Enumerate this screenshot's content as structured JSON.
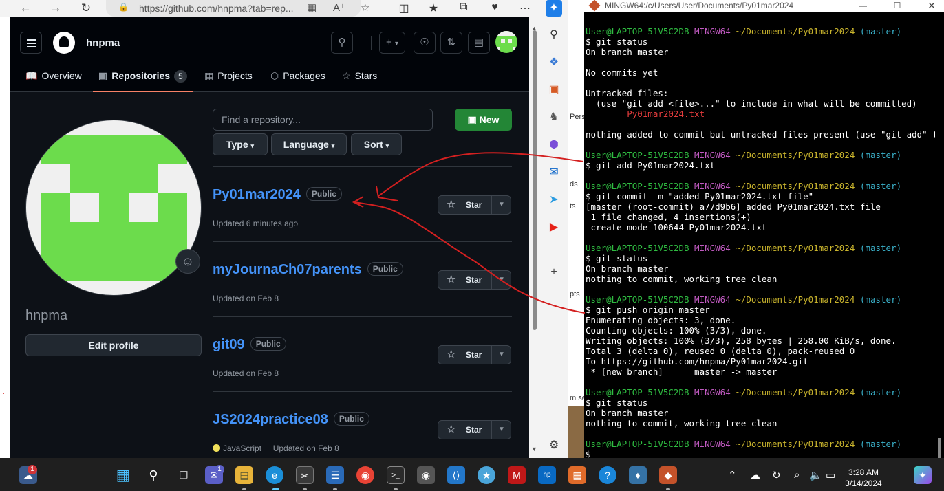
{
  "browser": {
    "url": "https://github.com/hnpma?tab=rep..."
  },
  "github": {
    "username": "hnpma",
    "tabs": [
      {
        "label": "Overview",
        "icon": "book-icon"
      },
      {
        "label": "Repositories",
        "icon": "repo-icon",
        "count": "5",
        "active": true
      },
      {
        "label": "Projects",
        "icon": "table-icon"
      },
      {
        "label": "Packages",
        "icon": "package-icon"
      },
      {
        "label": "Stars",
        "icon": "star-icon"
      }
    ],
    "profile": {
      "name": "hnpma",
      "edit_label": "Edit profile"
    },
    "search_placeholder": "Find a repository...",
    "new_label": "New",
    "filters": [
      "Type",
      "Language",
      "Sort"
    ],
    "repos": [
      {
        "name": "Py01mar2024",
        "visibility": "Public",
        "updated": "Updated 6 minutes ago",
        "star_label": "Star"
      },
      {
        "name": "myJournaCh07parents",
        "visibility": "Public",
        "updated": "Updated on Feb 8",
        "star_label": "Star"
      },
      {
        "name": "git09",
        "visibility": "Public",
        "updated": "Updated on Feb 8",
        "star_label": "Star"
      },
      {
        "name": "JS2024practice08",
        "visibility": "Public",
        "language": "JavaScript",
        "updated": "Updated on Feb 8",
        "star_label": "Star"
      }
    ]
  },
  "background_window": {
    "fragments": [
      "Pers",
      "ds",
      "ts",
      "pts",
      "m se"
    ]
  },
  "terminal": {
    "title": "MINGW64:/c/Users/User/Documents/Py01mar2024",
    "prompt_user": "User@LAPTOP-51V5C2DB",
    "prompt_env": "MINGW64",
    "prompt_path": "~/Documents/Py01mar2024",
    "prompt_branch": "(master)",
    "lines": [
      {
        "type": "cmd",
        "text": "$ git status"
      },
      {
        "type": "out",
        "text": "On branch master"
      },
      {
        "type": "out",
        "text": ""
      },
      {
        "type": "out",
        "text": "No commits yet"
      },
      {
        "type": "out",
        "text": ""
      },
      {
        "type": "out",
        "text": "Untracked files:"
      },
      {
        "type": "out",
        "text": "  (use \"git add <file>...\" to include in what will be committed)"
      },
      {
        "type": "red",
        "text": "        Py01mar2024.txt"
      },
      {
        "type": "out",
        "text": ""
      },
      {
        "type": "out",
        "text": "nothing added to commit but untracked files present (use \"git add\" to track)"
      },
      {
        "type": "out",
        "text": ""
      },
      {
        "type": "prompt"
      },
      {
        "type": "cmd",
        "text": "$ git add Py01mar2024.txt"
      },
      {
        "type": "out",
        "text": ""
      },
      {
        "type": "prompt"
      },
      {
        "type": "cmd",
        "text": "$ git commit -m \"added Py01mar2024.txt file\""
      },
      {
        "type": "out",
        "text": "[master (root-commit) a77d9b6] added Py01mar2024.txt file"
      },
      {
        "type": "out",
        "text": " 1 file changed, 4 insertions(+)"
      },
      {
        "type": "out",
        "text": " create mode 100644 Py01mar2024.txt"
      },
      {
        "type": "out",
        "text": ""
      },
      {
        "type": "prompt"
      },
      {
        "type": "cmd",
        "text": "$ git status"
      },
      {
        "type": "out",
        "text": "On branch master"
      },
      {
        "type": "out",
        "text": "nothing to commit, working tree clean"
      },
      {
        "type": "out",
        "text": ""
      },
      {
        "type": "prompt"
      },
      {
        "type": "cmd",
        "text": "$ git push origin master"
      },
      {
        "type": "out",
        "text": "Enumerating objects: 3, done."
      },
      {
        "type": "out",
        "text": "Counting objects: 100% (3/3), done."
      },
      {
        "type": "out",
        "text": "Writing objects: 100% (3/3), 258 bytes | 258.00 KiB/s, done."
      },
      {
        "type": "out",
        "text": "Total 3 (delta 0), reused 0 (delta 0), pack-reused 0"
      },
      {
        "type": "out",
        "text": "To https://github.com/hnpma/Py01mar2024.git"
      },
      {
        "type": "out",
        "text": " * [new branch]      master -> master"
      },
      {
        "type": "out",
        "text": ""
      },
      {
        "type": "prompt"
      },
      {
        "type": "cmd",
        "text": "$ git status"
      },
      {
        "type": "out",
        "text": "On branch master"
      },
      {
        "type": "out",
        "text": "nothing to commit, working tree clean"
      },
      {
        "type": "out",
        "text": ""
      },
      {
        "type": "prompt"
      },
      {
        "type": "cmd",
        "text": "$ "
      }
    ]
  },
  "taskbar": {
    "time": "3:28 AM",
    "date": "3/14/2024",
    "weather_badge": "1",
    "teams_badge": "1"
  },
  "colors": {
    "accent_green": "#238636",
    "link_blue": "#4493f8",
    "annotation_red": "#d42020",
    "avatar_green": "#6cdc4c"
  }
}
